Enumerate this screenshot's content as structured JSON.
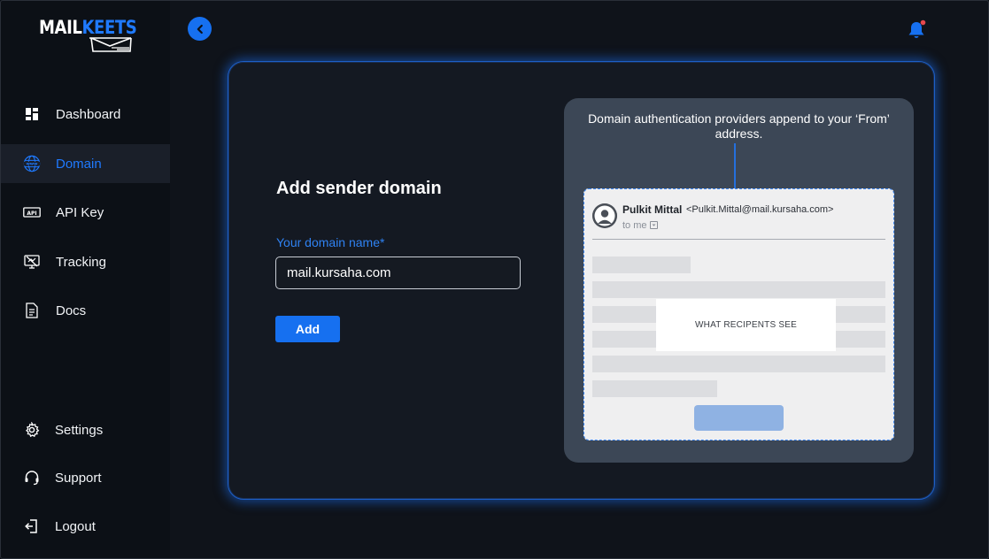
{
  "brand": {
    "logo_main": "MAIL",
    "logo_accent": "KEETS",
    "accent_color": "#1f7aff"
  },
  "sidebar": {
    "items": [
      {
        "label": "Dashboard",
        "icon": "dashboard-icon"
      },
      {
        "label": "Domain",
        "icon": "globe-www-icon",
        "active": true
      },
      {
        "label": "API Key",
        "icon": "api-key-icon"
      },
      {
        "label": "Tracking",
        "icon": "tracking-icon"
      },
      {
        "label": "Docs",
        "icon": "document-icon"
      }
    ],
    "bottom_items": [
      {
        "label": "Settings",
        "icon": "gear-icon"
      },
      {
        "label": "Support",
        "icon": "headset-icon"
      },
      {
        "label": "Logout",
        "icon": "logout-icon"
      }
    ]
  },
  "header": {
    "back_icon": "chevron-left-icon",
    "notification_icon": "bell-icon",
    "notification_dot_color": "#e5484d"
  },
  "form": {
    "title": "Add sender domain",
    "domain_label": "Your domain name*",
    "domain_value": "mail.kursaha.com",
    "add_label": "Add"
  },
  "preview": {
    "caption": "Domain authentication providers append to your ‘From’ address.",
    "sender_name": "Pulkit Mittal",
    "sender_email": "<Pulkit.Mittal@mail.kursaha.com>",
    "recipient_line": "to me",
    "overlay_label": "WHAT RECIPENTS SEE"
  }
}
